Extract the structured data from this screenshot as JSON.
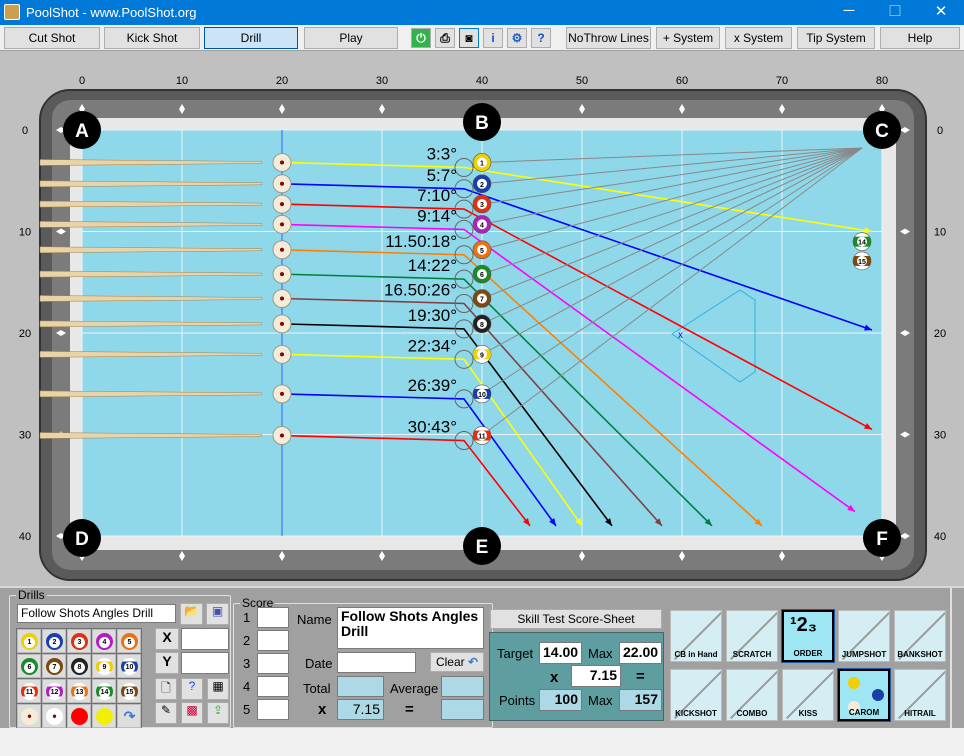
{
  "window": {
    "title": "PoolShot - www.PoolShot.org",
    "minimize": "─",
    "maximize": "☐",
    "close": "✕"
  },
  "toolbar": {
    "buttons": [
      "Cut Shot",
      "Kick Shot",
      "Drill",
      "Play"
    ],
    "selected": "Drill",
    "icons": [
      "power-icon",
      "printer-icon",
      "camera-icon",
      "info-icon",
      "gear-icon",
      "help-doc-icon"
    ],
    "right_buttons": [
      "NoThrow Lines",
      "+ System",
      "x System",
      "Tip System",
      "Help"
    ]
  },
  "table": {
    "x_ticks": [
      "0",
      "10",
      "20",
      "30",
      "40",
      "50",
      "60",
      "70",
      "80"
    ],
    "y_ticks": [
      "0",
      "10",
      "20",
      "30",
      "40"
    ],
    "pockets": [
      "A",
      "B",
      "C",
      "D",
      "E",
      "F"
    ],
    "cue_x": 20,
    "shots": [
      {
        "ball": "1",
        "color": "#f0d000",
        "line": "#ffff00",
        "y": 3.2,
        "label": "3:3°",
        "target": [
          79,
          10
        ]
      },
      {
        "ball": "2",
        "color": "#1a3fa8",
        "line": "#0000ff",
        "y": 5.3,
        "label": "5:7°",
        "target": [
          79,
          19.7
        ]
      },
      {
        "ball": "3",
        "color": "#e03010",
        "line": "#ff0000",
        "y": 7.3,
        "label": "7:10°",
        "target": [
          79,
          29.5
        ]
      },
      {
        "ball": "4",
        "color": "#b020c0",
        "line": "#ff00ff",
        "y": 9.3,
        "label": "9:14°",
        "target": [
          77.3,
          37.6
        ]
      },
      {
        "ball": "5",
        "color": "#f07010",
        "line": "#ff8000",
        "y": 11.8,
        "label": "11.50:18°",
        "target": [
          68,
          39
        ]
      },
      {
        "ball": "6",
        "color": "#1a8a2a",
        "line": "#008040",
        "y": 14.2,
        "label": "14:22°",
        "target": [
          63,
          39
        ]
      },
      {
        "ball": "7",
        "color": "#7a4a10",
        "line": "#804040",
        "y": 16.6,
        "label": "16.50:26°",
        "target": [
          58,
          39
        ]
      },
      {
        "ball": "8",
        "color": "#222222",
        "line": "#000000",
        "y": 19.1,
        "label": "19:30°",
        "target": [
          53,
          39
        ]
      },
      {
        "ball": "9",
        "color": "#f0d000",
        "line": "#ffff00",
        "y": 22.1,
        "label": "22:34°",
        "target": [
          50,
          39
        ]
      },
      {
        "ball": "10",
        "color": "#1a3fa8",
        "line": "#0000ff",
        "y": 26.0,
        "label": "26:39°",
        "target": [
          47.4,
          39
        ]
      },
      {
        "ball": "11",
        "color": "#e03010",
        "line": "#ff0000",
        "y": 30.1,
        "label": "30:43°",
        "target": [
          44.8,
          39
        ]
      }
    ],
    "extra_balls": [
      {
        "ball": "14",
        "color": "#1a8a2a",
        "x": 79,
        "y": 11
      },
      {
        "ball": "15",
        "color": "#7a4a10",
        "x": 79,
        "y": 12.9
      }
    ],
    "felt": "#8fd8ea"
  },
  "drills": {
    "legend": "Drills",
    "name": "Follow Shots Angles Drill",
    "x_label": "X",
    "y_label": "Y",
    "x_value": "",
    "y_value": "",
    "balls": [
      [
        "1",
        "#f0d000"
      ],
      [
        "2",
        "#1a3fa8"
      ],
      [
        "3",
        "#e03010"
      ],
      [
        "4",
        "#b020c0"
      ],
      [
        "5",
        "#f07010"
      ],
      [
        "6",
        "#1a8a2a"
      ],
      [
        "7",
        "#7a4a10"
      ],
      [
        "8",
        "#222222"
      ],
      [
        "9",
        "#f0d000"
      ],
      [
        "10",
        "#1a3fa8"
      ],
      [
        "11",
        "#e03010"
      ],
      [
        "12",
        "#b020c0"
      ],
      [
        "13",
        "#f07010"
      ],
      [
        "14",
        "#1a8a2a"
      ],
      [
        "15",
        "#7a4a10"
      ]
    ]
  },
  "score": {
    "legend": "Score",
    "rows": [
      "1",
      "2",
      "3",
      "4",
      "5"
    ],
    "name_label": "Name",
    "name": "Follow Shots Angles Drill",
    "date_label": "Date",
    "date": "",
    "clear": "Clear",
    "total_label": "Total",
    "total": "",
    "average_label": "Average",
    "average": "",
    "x_label": "x",
    "multiplier": "7.15",
    "eq": "=",
    "result": ""
  },
  "skill": {
    "button": "Skill Test Score-Sheet",
    "target_label": "Target",
    "target": "14.00",
    "max_label": "Max",
    "max": "22.00",
    "x": "x",
    "multiplier": "7.15",
    "eq": "=",
    "points_label": "Points",
    "points": "100",
    "points_max_label": "Max",
    "points_max": "157"
  },
  "shot_types": [
    {
      "label": "CB in Hand",
      "active": false
    },
    {
      "label": "SCRATCH",
      "active": false
    },
    {
      "label": "ORDER",
      "active": true,
      "glyph": "123"
    },
    {
      "label": "JUMPSHOT",
      "active": false
    },
    {
      "label": "BANKSHOT",
      "active": false
    },
    {
      "label": "KICKSHOT",
      "active": false
    },
    {
      "label": "COMBO",
      "active": false
    },
    {
      "label": "KISS",
      "active": false
    },
    {
      "label": "CAROM",
      "active": true
    },
    {
      "label": "HITRAIL",
      "active": false
    }
  ]
}
